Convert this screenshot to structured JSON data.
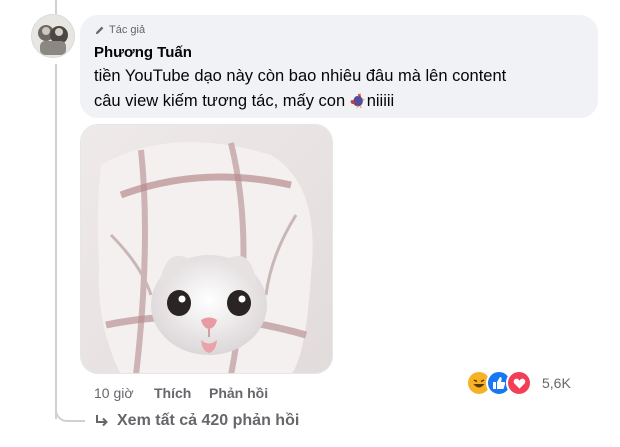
{
  "comment": {
    "badge": "Tác giả",
    "author": "Phương Tuấn",
    "text_line1": "tiền YouTube dạo này còn bao nhiêu đâu mà lên content",
    "text_line2": "câu view kiếm tương tác, mấy con ",
    "text_line2_end": "niiiii",
    "time": "10 giờ",
    "like": "Thích",
    "reply": "Phản hồi",
    "reaction_count": "5,6K",
    "reactions": [
      "haha-icon",
      "like-icon",
      "love-icon"
    ],
    "inline_emoji": "rooster-icon"
  },
  "replies": {
    "label": "Xem tất cả 420 phản hồi"
  },
  "colors": {
    "bubble": "#f0f2f5",
    "secondary_text": "#65676b",
    "like_blue": "#1877f2",
    "love_red": "#f33e58",
    "haha_yellow": "#f7b125"
  }
}
